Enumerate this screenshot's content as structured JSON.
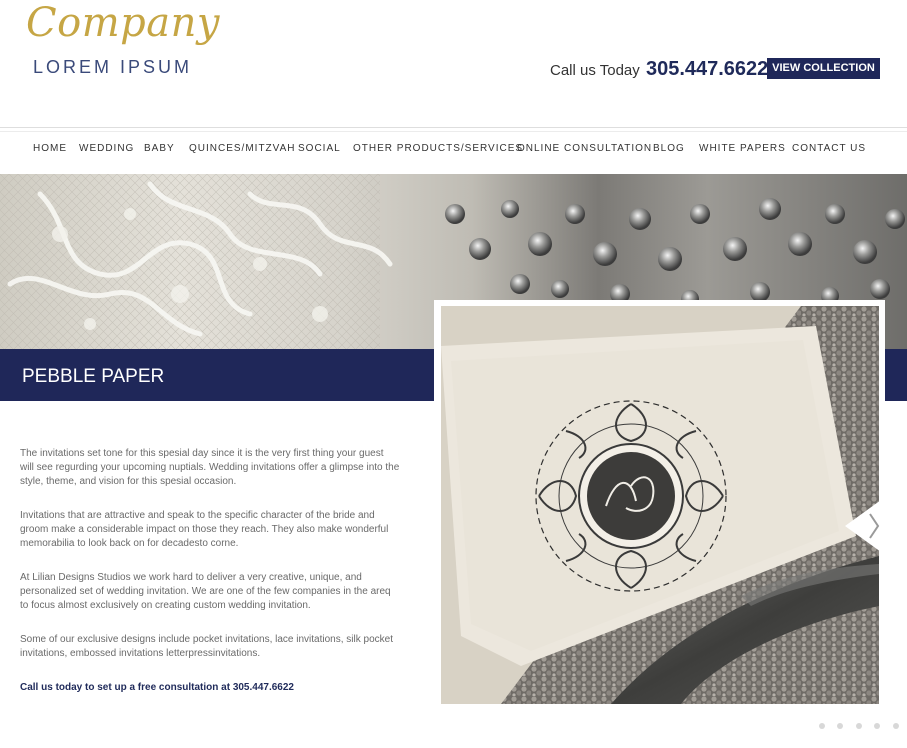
{
  "header": {
    "logo_script": "Company",
    "logo_sub": "LOREM IPSUM",
    "call_prefix": "Call us Today",
    "phone": "305.447.6622",
    "view_button": "VIEW COLLECTION"
  },
  "nav": [
    "HOME",
    "WEDDING",
    "BABY",
    "QUINCES/MITZVAH",
    "SOCIAL",
    "OTHER PRODUCTS/SERVICES",
    "ONLINE CONSULTATION",
    "BLOG",
    "WHITE PAPERS",
    "CONTACT US"
  ],
  "band": {
    "title": "PEBBLE PAPER"
  },
  "content": {
    "p1": "The invitations set tone for this spesial day since it is the very first thing your guest will see regurding your upcoming nuptials. Wedding invitations offer a glimpse into the style, theme, and vision for this spesial occasion.",
    "p2": "Invitations that are attractive and speak to the specific character of the bride and groom make a considerable impact on those they reach. They also make wonderful memorabilia to look back on for decadesto corne.",
    "p3": "At Lilian Designs Studios we work hard to deliver a very creative, unique, and personalized set of wedding invitation. We are one of the few companies in the areq to focus almost exclusively on creating custom wedding invitation.",
    "p4": "Some of our exclusive designs include pocket invitations, lace invitations, silk pocket invitations, embossed invitations letterpressinvitations.",
    "cta": "Call us today to set up a free consultation at 305.447.6622"
  },
  "colors": {
    "navy": "#1f2759",
    "gold": "#c6a645"
  },
  "icons": {
    "next": "chevron-right-icon"
  },
  "slider": {
    "slides": 5
  }
}
